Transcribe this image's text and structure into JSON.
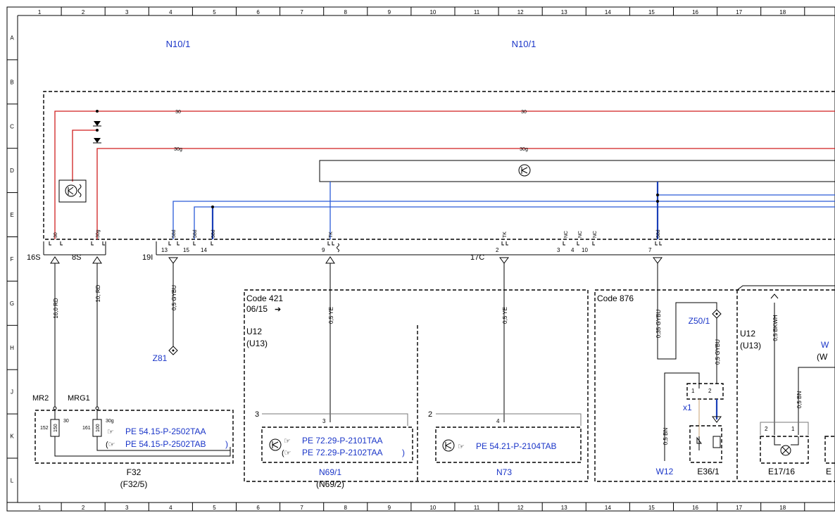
{
  "grid": {
    "columns": [
      "1",
      "2",
      "3",
      "4",
      "5",
      "6",
      "7",
      "8",
      "9",
      "10",
      "11",
      "12",
      "13",
      "14",
      "15",
      "16",
      "17",
      "18"
    ],
    "rows": [
      "A",
      "B",
      "C",
      "D",
      "E",
      "F",
      "G",
      "H",
      "J",
      "K",
      "L"
    ]
  },
  "components": {
    "top_left": "N10/1",
    "top_center": "N10/1",
    "fuse": "F32",
    "fuse_alt": "(F32/5)",
    "n69": "N69/1",
    "n69_alt": "(N69/2)",
    "n73": "N73",
    "z81": "Z81",
    "z50": "Z50/1",
    "w12": "W12",
    "e36": "E36/1",
    "e17": "E17/16",
    "x1": "x1",
    "w_partial": "W",
    "w_partial2": "(W",
    "e_partial": "E"
  },
  "codes": {
    "code421": "Code 421",
    "date": "06/15",
    "u12": "U12",
    "u13": "(U13)",
    "code876": "Code 876",
    "u12b": "U12",
    "u13b": "(U13)"
  },
  "wires": {
    "w30": "30",
    "w30g": "30g",
    "w58d": "58d",
    "wTK": "TK",
    "wNC": "NC",
    "rd16": "16,0 RD",
    "rd10": "10, RD",
    "gybu05": "0,5 GYBU",
    "ye05a": "0,5 YE",
    "ye05b": "0,5 YE",
    "gybu035": "0,35 GYBU",
    "gybu05b": "0,5 GYBU",
    "bn05a": "0,5 BN",
    "bn05b": "0,5 BN",
    "bkwh05": "0,5 BKWH"
  },
  "connectors": {
    "s16": "16S",
    "s8": "8S",
    "i19": "19I",
    "c17": "17C",
    "p13": "13",
    "p15": "15",
    "p14": "14",
    "p9": "9",
    "p2": "2",
    "p3": "3",
    "p4": "4",
    "p10": "10",
    "p7": "7",
    "mr2": "MR2",
    "mrg1": "MRG1",
    "f152": "152",
    "f150": "150",
    "f161": "161",
    "f100": "100",
    "f30": "30",
    "f30g": "30g",
    "k3": "3",
    "k3b": "3",
    "k2": "2",
    "k4": "4",
    "x1p1": "1",
    "x1p2": "2",
    "e17p2": "2",
    "e17p1": "1"
  },
  "refs": {
    "pe1": "PE 54.15-P-2502TAA",
    "pe2": "PE 54.15-P-2502TAB",
    "pe3": "PE 72.29-P-2101TAA",
    "pe4": "PE 72.29-P-2102TAA",
    "pe5": "PE 54.21-P-2104TAB"
  }
}
